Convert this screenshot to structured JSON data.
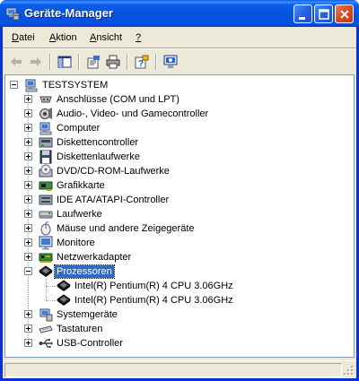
{
  "window": {
    "title": "Geräte-Manager"
  },
  "menu": {
    "items": [
      {
        "label": "Datei",
        "accel": "D",
        "rest": "atei"
      },
      {
        "label": "Aktion",
        "accel": "A",
        "rest": "ktion"
      },
      {
        "label": "Ansicht",
        "accel": "A",
        "rest": "nsicht"
      },
      {
        "label": "?",
        "accel": "?",
        "rest": ""
      }
    ]
  },
  "toolbar": {
    "buttons": [
      {
        "icon": "back-arrow-icon",
        "enabled": false
      },
      {
        "icon": "forward-arrow-icon",
        "enabled": false
      },
      {
        "icon": "show-hide-tree-icon",
        "enabled": true
      },
      {
        "icon": "properties-icon",
        "enabled": true
      },
      {
        "icon": "print-icon",
        "enabled": true
      },
      {
        "icon": "help-icon",
        "enabled": true
      },
      {
        "icon": "scan-hardware-icon",
        "enabled": true
      }
    ]
  },
  "tree": {
    "root": {
      "label": "TESTSYSTEM",
      "icon": "computer-icon"
    },
    "nodes": [
      {
        "label": "Anschlüsse (COM und LPT)",
        "icon": "port-icon"
      },
      {
        "label": "Audio-, Video- und Gamecontroller",
        "icon": "audio-icon"
      },
      {
        "label": "Computer",
        "icon": "computer-icon"
      },
      {
        "label": "Diskettencontroller",
        "icon": "floppy-controller-icon"
      },
      {
        "label": "Diskettenlaufwerke",
        "icon": "floppy-drive-icon"
      },
      {
        "label": "DVD/CD-ROM-Laufwerke",
        "icon": "cdrom-icon"
      },
      {
        "label": "Grafikkarte",
        "icon": "display-adapter-icon"
      },
      {
        "label": "IDE ATA/ATAPI-Controller",
        "icon": "ide-controller-icon"
      },
      {
        "label": "Laufwerke",
        "icon": "hard-disk-icon"
      },
      {
        "label": "Mäuse und andere Zeigegeräte",
        "icon": "mouse-icon"
      },
      {
        "label": "Monitore",
        "icon": "monitor-icon"
      },
      {
        "label": "Netzwerkadapter",
        "icon": "network-adapter-icon"
      },
      {
        "label": "Prozessoren",
        "icon": "processor-icon",
        "expanded": true,
        "selected": true,
        "children": [
          {
            "label": "Intel(R) Pentium(R) 4 CPU 3.06GHz",
            "icon": "processor-icon"
          },
          {
            "label": "Intel(R) Pentium(R) 4 CPU 3.06GHz",
            "icon": "processor-icon"
          }
        ]
      },
      {
        "label": "Systemgeräte",
        "icon": "system-devices-icon"
      },
      {
        "label": "Tastaturen",
        "icon": "keyboard-icon"
      },
      {
        "label": "USB-Controller",
        "icon": "usb-icon"
      }
    ]
  },
  "colors": {
    "title_bar": "#0553dc",
    "selection": "#316ac5",
    "face": "#ece9d8"
  }
}
